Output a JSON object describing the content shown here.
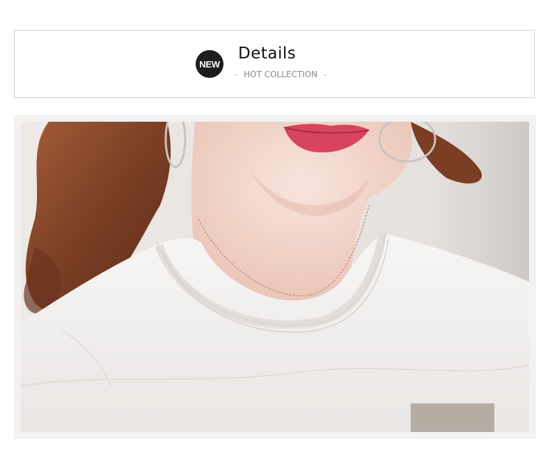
{
  "header": {
    "badge_text": "NEW",
    "title": "Details",
    "subtitle": "HOT COLLECTION",
    "subtitle_dash_left": "-",
    "subtitle_dash_right": "-"
  },
  "photo": {
    "subject": "model-neckline-closeup",
    "colors": {
      "shirt": "#f4f2f1",
      "skin": "#f3d9cf",
      "hair": "#8a4a2c",
      "lips": "#d8435e",
      "background": "#e7e2df"
    }
  }
}
